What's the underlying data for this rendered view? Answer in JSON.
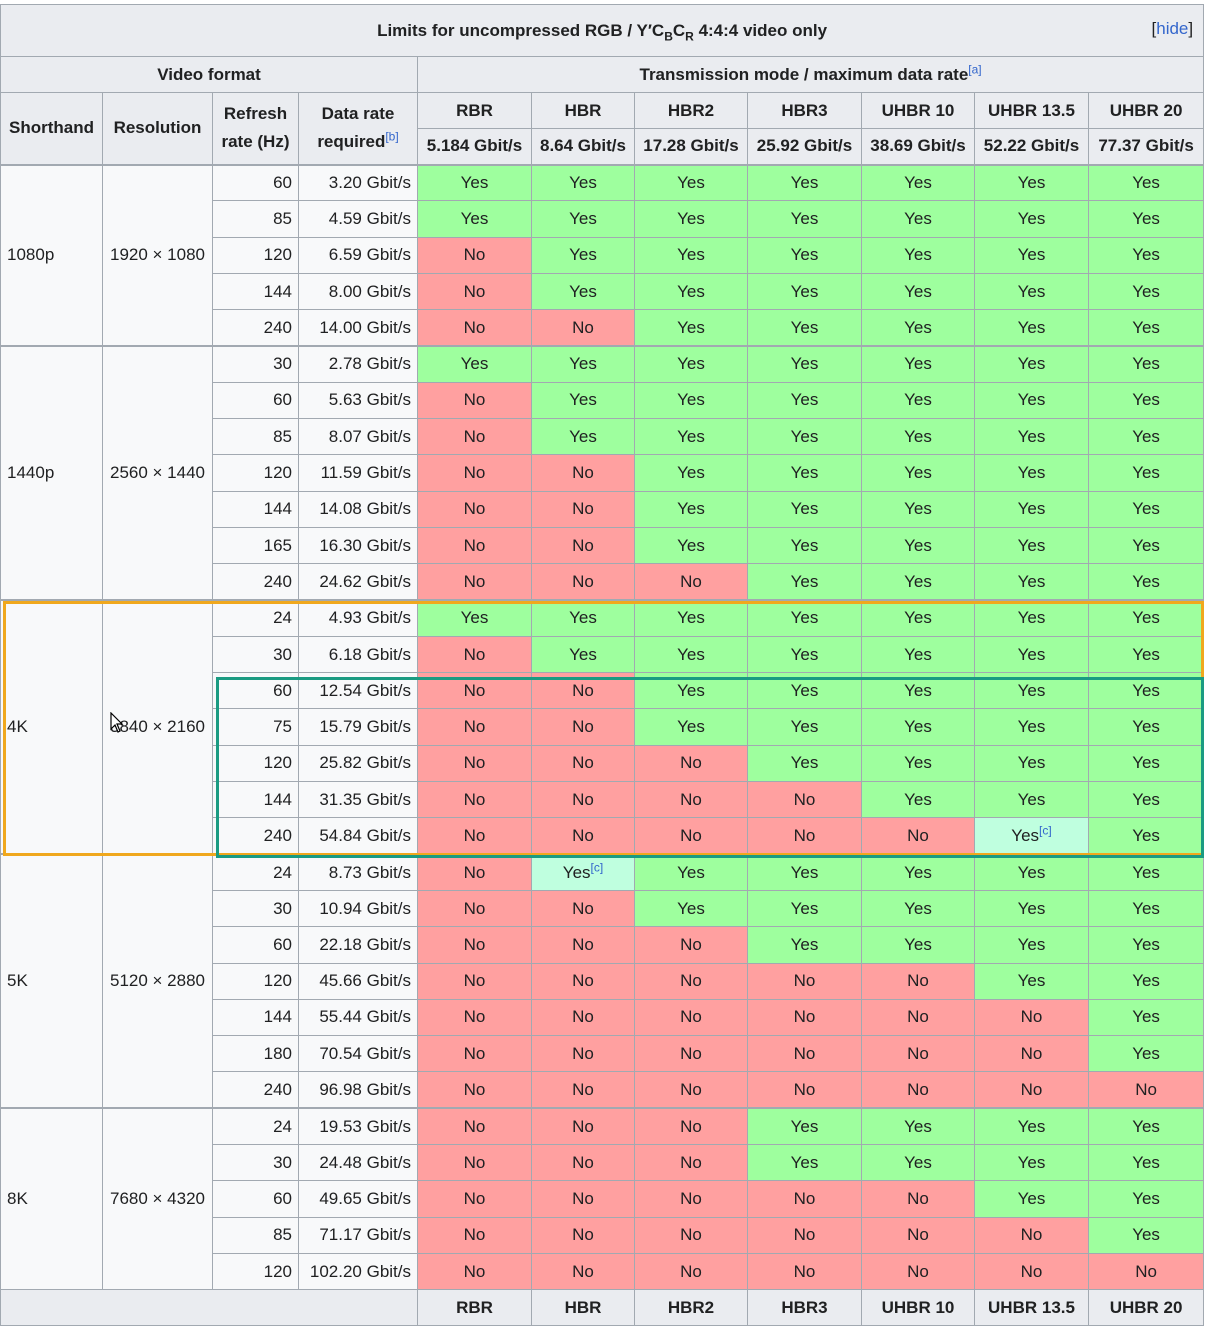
{
  "table": {
    "caption_prefix": "Limits for uncompressed RGB / Y′C",
    "caption_sub_b": "B",
    "caption_c": "C",
    "caption_sub_r": "R",
    "caption_suffix": " 4:4:4 video only",
    "hide_open": "[",
    "hide_label": "hide",
    "hide_close": "]",
    "video_format_header": "Video format",
    "transmission_header": "Transmission mode / maximum data rate",
    "transmission_note": "[a]",
    "shorthand_header": "Shorthand",
    "resolution_header": "Resolution",
    "refresh_header_line1": "Refresh",
    "refresh_header_line2": "rate (Hz)",
    "datarate_header_line1": "Data rate",
    "datarate_header_line2": "required",
    "datarate_note": "[b]",
    "modes": [
      "RBR",
      "HBR",
      "HBR2",
      "HBR3",
      "UHBR 10",
      "UHBR 13.5",
      "UHBR 20"
    ],
    "mode_rates": [
      "5.184 Gbit/s",
      "8.64 Gbit/s",
      "17.28 Gbit/s",
      "25.92 Gbit/s",
      "38.69 Gbit/s",
      "52.22 Gbit/s",
      "77.37 Gbit/s"
    ],
    "footnote_c": "[c]",
    "groups": [
      {
        "shorthand": "1080p",
        "resolution": "1920 × 1080",
        "rows": [
          {
            "rate": "60",
            "datarate": "3.20 Gbit/s",
            "cells": [
              "Yes",
              "Yes",
              "Yes",
              "Yes",
              "Yes",
              "Yes",
              "Yes"
            ]
          },
          {
            "rate": "85",
            "datarate": "4.59 Gbit/s",
            "cells": [
              "Yes",
              "Yes",
              "Yes",
              "Yes",
              "Yes",
              "Yes",
              "Yes"
            ]
          },
          {
            "rate": "120",
            "datarate": "6.59 Gbit/s",
            "cells": [
              "No",
              "Yes",
              "Yes",
              "Yes",
              "Yes",
              "Yes",
              "Yes"
            ]
          },
          {
            "rate": "144",
            "datarate": "8.00 Gbit/s",
            "cells": [
              "No",
              "Yes",
              "Yes",
              "Yes",
              "Yes",
              "Yes",
              "Yes"
            ]
          },
          {
            "rate": "240",
            "datarate": "14.00 Gbit/s",
            "cells": [
              "No",
              "No",
              "Yes",
              "Yes",
              "Yes",
              "Yes",
              "Yes"
            ]
          }
        ]
      },
      {
        "shorthand": "1440p",
        "resolution": "2560 × 1440",
        "rows": [
          {
            "rate": "30",
            "datarate": "2.78 Gbit/s",
            "cells": [
              "Yes",
              "Yes",
              "Yes",
              "Yes",
              "Yes",
              "Yes",
              "Yes"
            ]
          },
          {
            "rate": "60",
            "datarate": "5.63 Gbit/s",
            "cells": [
              "No",
              "Yes",
              "Yes",
              "Yes",
              "Yes",
              "Yes",
              "Yes"
            ]
          },
          {
            "rate": "85",
            "datarate": "8.07 Gbit/s",
            "cells": [
              "No",
              "Yes",
              "Yes",
              "Yes",
              "Yes",
              "Yes",
              "Yes"
            ]
          },
          {
            "rate": "120",
            "datarate": "11.59 Gbit/s",
            "cells": [
              "No",
              "No",
              "Yes",
              "Yes",
              "Yes",
              "Yes",
              "Yes"
            ]
          },
          {
            "rate": "144",
            "datarate": "14.08 Gbit/s",
            "cells": [
              "No",
              "No",
              "Yes",
              "Yes",
              "Yes",
              "Yes",
              "Yes"
            ]
          },
          {
            "rate": "165",
            "datarate": "16.30 Gbit/s",
            "cells": [
              "No",
              "No",
              "Yes",
              "Yes",
              "Yes",
              "Yes",
              "Yes"
            ]
          },
          {
            "rate": "240",
            "datarate": "24.62 Gbit/s",
            "cells": [
              "No",
              "No",
              "No",
              "Yes",
              "Yes",
              "Yes",
              "Yes"
            ]
          }
        ]
      },
      {
        "shorthand": "4K",
        "resolution": "3840 × 2160",
        "rows": [
          {
            "rate": "24",
            "datarate": "4.93 Gbit/s",
            "cells": [
              "Yes",
              "Yes",
              "Yes",
              "Yes",
              "Yes",
              "Yes",
              "Yes"
            ]
          },
          {
            "rate": "30",
            "datarate": "6.18 Gbit/s",
            "cells": [
              "No",
              "Yes",
              "Yes",
              "Yes",
              "Yes",
              "Yes",
              "Yes"
            ]
          },
          {
            "rate": "60",
            "datarate": "12.54 Gbit/s",
            "cells": [
              "No",
              "No",
              "Yes",
              "Yes",
              "Yes",
              "Yes",
              "Yes"
            ]
          },
          {
            "rate": "75",
            "datarate": "15.79 Gbit/s",
            "cells": [
              "No",
              "No",
              "Yes",
              "Yes",
              "Yes",
              "Yes",
              "Yes"
            ]
          },
          {
            "rate": "120",
            "datarate": "25.82 Gbit/s",
            "cells": [
              "No",
              "No",
              "No",
              "Yes",
              "Yes",
              "Yes",
              "Yes"
            ]
          },
          {
            "rate": "144",
            "datarate": "31.35 Gbit/s",
            "cells": [
              "No",
              "No",
              "No",
              "No",
              "Yes",
              "Yes",
              "Yes"
            ]
          },
          {
            "rate": "240",
            "datarate": "54.84 Gbit/s",
            "cells": [
              "No",
              "No",
              "No",
              "No",
              "No",
              "Yes[c]",
              "Yes"
            ]
          }
        ]
      },
      {
        "shorthand": "5K",
        "resolution": "5120 × 2880",
        "rows": [
          {
            "rate": "24",
            "datarate": "8.73 Gbit/s",
            "cells": [
              "No",
              "Yes[c]",
              "Yes",
              "Yes",
              "Yes",
              "Yes",
              "Yes"
            ]
          },
          {
            "rate": "30",
            "datarate": "10.94 Gbit/s",
            "cells": [
              "No",
              "No",
              "Yes",
              "Yes",
              "Yes",
              "Yes",
              "Yes"
            ]
          },
          {
            "rate": "60",
            "datarate": "22.18 Gbit/s",
            "cells": [
              "No",
              "No",
              "No",
              "Yes",
              "Yes",
              "Yes",
              "Yes"
            ]
          },
          {
            "rate": "120",
            "datarate": "45.66 Gbit/s",
            "cells": [
              "No",
              "No",
              "No",
              "No",
              "No",
              "Yes",
              "Yes"
            ]
          },
          {
            "rate": "144",
            "datarate": "55.44 Gbit/s",
            "cells": [
              "No",
              "No",
              "No",
              "No",
              "No",
              "No",
              "Yes"
            ]
          },
          {
            "rate": "180",
            "datarate": "70.54 Gbit/s",
            "cells": [
              "No",
              "No",
              "No",
              "No",
              "No",
              "No",
              "Yes"
            ]
          },
          {
            "rate": "240",
            "datarate": "96.98 Gbit/s",
            "cells": [
              "No",
              "No",
              "No",
              "No",
              "No",
              "No",
              "No"
            ]
          }
        ]
      },
      {
        "shorthand": "8K",
        "resolution": "7680 × 4320",
        "rows": [
          {
            "rate": "24",
            "datarate": "19.53 Gbit/s",
            "cells": [
              "No",
              "No",
              "No",
              "Yes",
              "Yes",
              "Yes",
              "Yes"
            ]
          },
          {
            "rate": "30",
            "datarate": "24.48 Gbit/s",
            "cells": [
              "No",
              "No",
              "No",
              "Yes",
              "Yes",
              "Yes",
              "Yes"
            ]
          },
          {
            "rate": "60",
            "datarate": "49.65 Gbit/s",
            "cells": [
              "No",
              "No",
              "No",
              "No",
              "No",
              "Yes",
              "Yes"
            ]
          },
          {
            "rate": "85",
            "datarate": "71.17 Gbit/s",
            "cells": [
              "No",
              "No",
              "No",
              "No",
              "No",
              "No",
              "Yes"
            ]
          },
          {
            "rate": "120",
            "datarate": "102.20 Gbit/s",
            "cells": [
              "No",
              "No",
              "No",
              "No",
              "No",
              "No",
              "No"
            ]
          }
        ]
      }
    ],
    "colors": {
      "yes": "#9eff9e",
      "no": "#ffa0a0",
      "partial": "#bfffdf",
      "header": "#eaecf0",
      "link": "#3366cc"
    }
  },
  "overlays": {
    "orange_box_color": "#f0a81d",
    "teal_box_color": "#1a9b82",
    "cursor": "mouse-pointer-icon"
  }
}
